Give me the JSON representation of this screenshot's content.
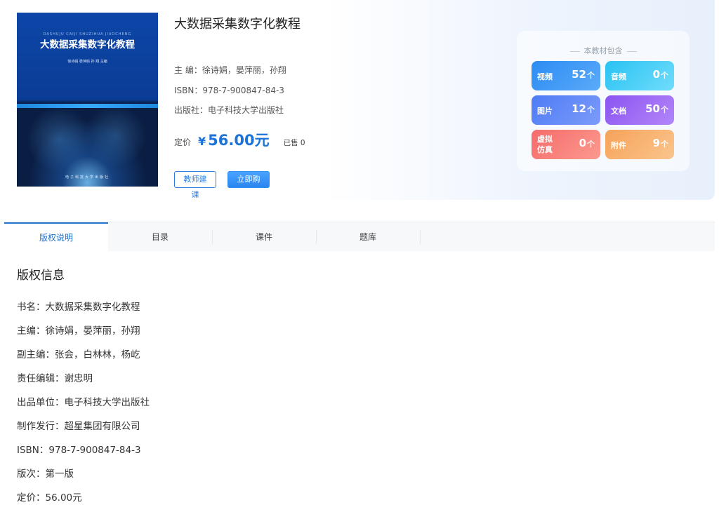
{
  "book": {
    "cover_sub": "DASHUJU CAIJI SHUZIHUA JIAOCHENG",
    "cover_title": "大数据采集数字化教程",
    "cover_authors": "徐诗娟  晏萍丽  孙 翔  主编",
    "cover_publisher": "电子科技大学出版社",
    "title": "大数据采集数字化教程",
    "editor_line": "主 编：徐诗娟，晏萍丽，孙翔",
    "isbn_line": "ISBN：978-7-900847-84-3",
    "publisher_line": "出版社：电子科技大学出版社",
    "price_label": "定价",
    "price_currency": "¥",
    "price_value": "56.00元",
    "sold": "已售 0"
  },
  "buttons": {
    "teacher": "教师建课",
    "buy": "立即购买"
  },
  "resources": {
    "title": "本教材包含",
    "items": [
      {
        "label": "视频",
        "count": "52",
        "arrow": "个"
      },
      {
        "label": "音频",
        "count": "0",
        "arrow": "个"
      },
      {
        "label": "图片",
        "count": "12",
        "arrow": "个"
      },
      {
        "label": "文档",
        "count": "50",
        "arrow": "个"
      },
      {
        "label": "虚拟仿真",
        "count": "0",
        "arrow": "个"
      },
      {
        "label": "附件",
        "count": "9",
        "arrow": "个"
      }
    ]
  },
  "tabs": [
    {
      "label": "版权说明"
    },
    {
      "label": "目录"
    },
    {
      "label": "课件"
    },
    {
      "label": "题库"
    }
  ],
  "copyright": {
    "heading": "版权信息",
    "lines": [
      "书名：大数据采集数字化教程",
      "主编：徐诗娟，晏萍丽，孙翔",
      "副主编：张会，白林林，杨屹",
      "责任编辑：谢忠明",
      "出品单位：电子科技大学出版社",
      "制作发行：超星集团有限公司",
      "ISBN：978-7-900847-84-3",
      "版次：第一版",
      "定价：56.00元"
    ]
  }
}
